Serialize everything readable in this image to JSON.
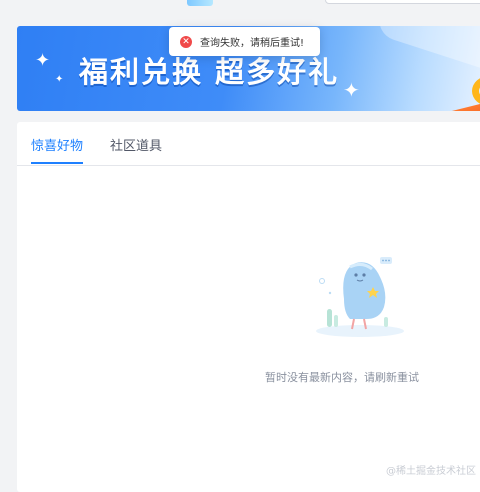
{
  "toast": {
    "icon": "error-icon",
    "message": "查询失败，请稍后重试!"
  },
  "banner": {
    "title": "福利兑换 超多好礼"
  },
  "tabs": [
    {
      "label": "惊喜好物",
      "active": true
    },
    {
      "label": "社区道具",
      "active": false
    }
  ],
  "empty_state": {
    "message": "暂时没有最新内容，请刷新重试"
  },
  "watermark": "@稀土掘金技术社区",
  "colors": {
    "accent": "#1e80ff",
    "error": "#f04a4a",
    "page_bg": "#f2f3f5"
  }
}
